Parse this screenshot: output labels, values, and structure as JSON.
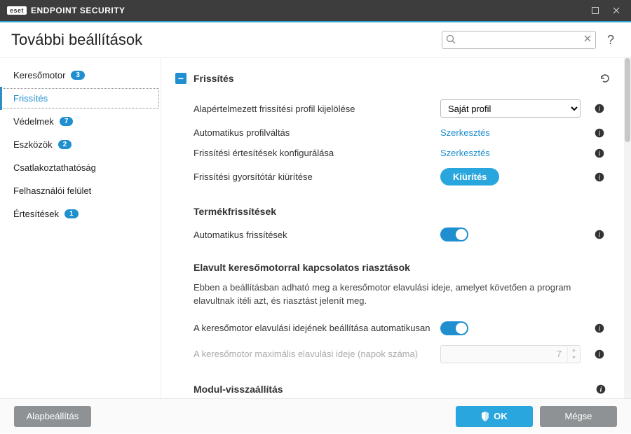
{
  "window": {
    "brand_badge": "eset",
    "brand_text": "ENDPOINT SECURITY"
  },
  "header": {
    "title": "További beállítások",
    "search_placeholder": "",
    "help": "?"
  },
  "sidebar": {
    "items": [
      {
        "label": "Keresőmotor",
        "badge": "3"
      },
      {
        "label": "Frissítés",
        "badge": ""
      },
      {
        "label": "Védelmek",
        "badge": "7"
      },
      {
        "label": "Eszközök",
        "badge": "2"
      },
      {
        "label": "Csatlakoztathatóság",
        "badge": ""
      },
      {
        "label": "Felhasználói felület",
        "badge": ""
      },
      {
        "label": "Értesítések",
        "badge": "1"
      }
    ]
  },
  "main": {
    "section_title": "Frissítés",
    "rows": {
      "default_profile_label": "Alapértelmezett frissítési profil kijelölése",
      "default_profile_value": "Saját profil",
      "auto_profile_label": "Automatikus profilváltás",
      "auto_profile_link": "Szerkesztés",
      "notif_label": "Frissítési értesítések konfigurálása",
      "notif_link": "Szerkesztés",
      "cache_label": "Frissítési gyorsítótár kiürítése",
      "cache_btn": "Kiürítés"
    },
    "product_updates": {
      "heading": "Termékfrissítések",
      "auto_label": "Automatikus frissítések"
    },
    "outdated": {
      "heading": "Elavult keresőmotorral kapcsolatos riasztások",
      "desc": "Ebben a beállításban adható meg a keresőmotor elavulási ideje, amelyet követően a program elavultnak ítéli azt, és riasztást jelenít meg.",
      "auto_set_label": "A keresőmotor elavulási idejének beállítása automatikusan",
      "max_age_label": "A keresőmotor maximális elavulási ideje (napok száma)",
      "max_age_value": "7"
    },
    "module_reset": {
      "heading": "Modul-visszaállítás"
    }
  },
  "footer": {
    "defaults": "Alapbeállítás",
    "ok": "OK",
    "cancel": "Mégse"
  }
}
